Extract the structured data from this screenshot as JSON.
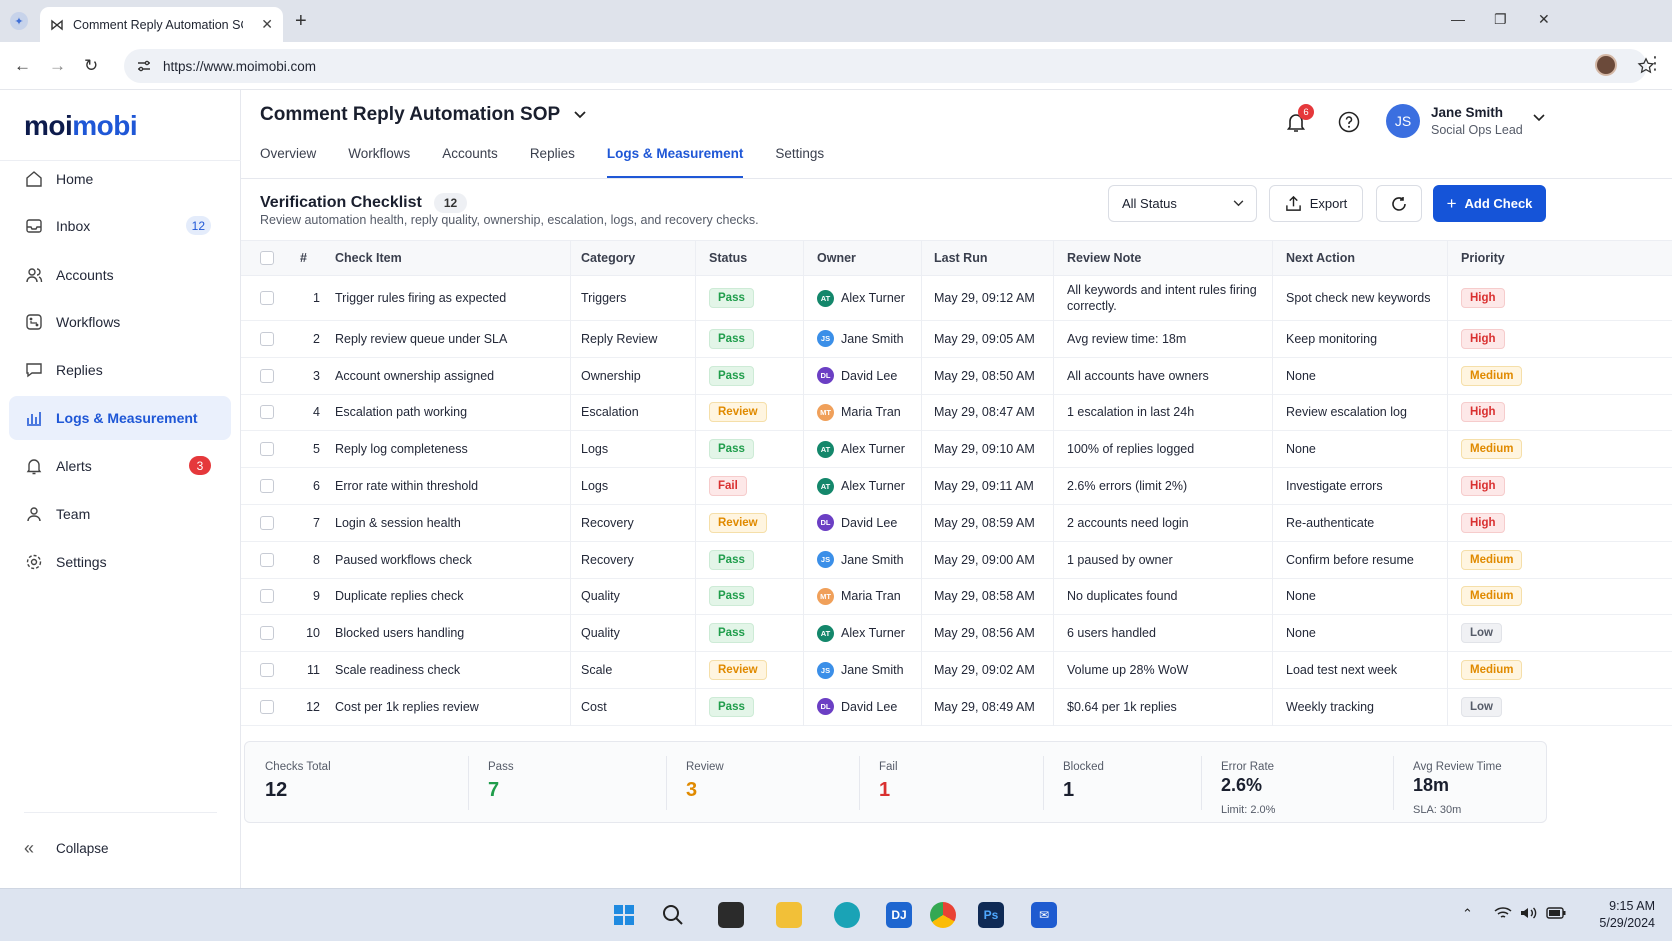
{
  "browser": {
    "tab_title": "Comment Reply Automation SO",
    "url": "https://www.moimobi.com"
  },
  "sidebar": {
    "logo": "moimobi",
    "items": [
      {
        "label": "Home",
        "icon": "home-icon"
      },
      {
        "label": "Inbox",
        "icon": "inbox-icon",
        "badge": "12"
      },
      {
        "label": "Accounts",
        "icon": "accounts-icon"
      },
      {
        "label": "Workflows",
        "icon": "workflows-icon"
      },
      {
        "label": "Replies",
        "icon": "replies-icon"
      },
      {
        "label": "Logs & Measurement",
        "icon": "chart-icon",
        "active": true
      },
      {
        "label": "Alerts",
        "icon": "bell-icon",
        "badge": "3"
      },
      {
        "label": "Team",
        "icon": "team-icon"
      },
      {
        "label": "Settings",
        "icon": "gear-icon"
      }
    ],
    "collapse_label": "Collapse"
  },
  "header": {
    "title": "Comment Reply Automation SOP",
    "tabs": [
      "Overview",
      "Workflows",
      "Accounts",
      "Replies",
      "Logs & Measurement",
      "Settings"
    ],
    "active_tab": "Logs & Measurement",
    "notifications": "6",
    "user": {
      "initials": "JS",
      "name": "Jane Smith",
      "role": "Social Ops Lead"
    }
  },
  "checklist": {
    "title": "Verification Checklist",
    "count": "12",
    "subtitle": "Review automation health, reply quality, ownership, escalation, logs, and recovery checks.",
    "filter_value": "All Status",
    "export_label": "Export",
    "add_label": "Add Check",
    "columns": [
      "#",
      "Check Item",
      "Category",
      "Status",
      "Owner",
      "Last Run",
      "Review Note",
      "Next Action",
      "Priority"
    ],
    "rows": [
      {
        "n": "1",
        "item": "Trigger rules firing as expected",
        "category": "Triggers",
        "status": "Pass",
        "owner": "Alex Turner",
        "initials": "AT",
        "last_run": "May 29, 09:12 AM",
        "note": "All keywords and intent rules firing correctly.",
        "next": "Spot check new keywords",
        "priority": "High"
      },
      {
        "n": "2",
        "item": "Reply review queue under SLA",
        "category": "Reply Review",
        "status": "Pass",
        "owner": "Jane Smith",
        "initials": "JS",
        "last_run": "May 29, 09:05 AM",
        "note": "Avg review time: 18m",
        "next": "Keep monitoring",
        "priority": "High"
      },
      {
        "n": "3",
        "item": "Account ownership assigned",
        "category": "Ownership",
        "status": "Pass",
        "owner": "David Lee",
        "initials": "DL",
        "last_run": "May 29, 08:50 AM",
        "note": "All accounts have owners",
        "next": "None",
        "priority": "Medium"
      },
      {
        "n": "4",
        "item": "Escalation path working",
        "category": "Escalation",
        "status": "Review",
        "owner": "Maria Tran",
        "initials": "MT",
        "last_run": "May 29, 08:47 AM",
        "note": "1 escalation in last 24h",
        "next": "Review escalation log",
        "priority": "High"
      },
      {
        "n": "5",
        "item": "Reply log completeness",
        "category": "Logs",
        "status": "Pass",
        "owner": "Alex Turner",
        "initials": "AT",
        "last_run": "May 29, 09:10 AM",
        "note": "100% of replies logged",
        "next": "None",
        "priority": "Medium"
      },
      {
        "n": "6",
        "item": "Error rate within threshold",
        "category": "Logs",
        "status": "Fail",
        "owner": "Alex Turner",
        "initials": "AT",
        "last_run": "May 29, 09:11 AM",
        "note": "2.6% errors (limit 2%)",
        "next": "Investigate errors",
        "priority": "High"
      },
      {
        "n": "7",
        "item": "Login & session health",
        "category": "Recovery",
        "status": "Review",
        "owner": "David Lee",
        "initials": "DL",
        "last_run": "May 29, 08:59 AM",
        "note": "2 accounts need login",
        "next": "Re-authenticate",
        "priority": "High"
      },
      {
        "n": "8",
        "item": "Paused workflows check",
        "category": "Recovery",
        "status": "Pass",
        "owner": "Jane Smith",
        "initials": "JS",
        "last_run": "May 29, 09:00 AM",
        "note": "1 paused by owner",
        "next": "Confirm before resume",
        "priority": "Medium"
      },
      {
        "n": "9",
        "item": "Duplicate replies check",
        "category": "Quality",
        "status": "Pass",
        "owner": "Maria Tran",
        "initials": "MT",
        "last_run": "May 29, 08:58 AM",
        "note": "No duplicates found",
        "next": "None",
        "priority": "Medium"
      },
      {
        "n": "10",
        "item": "Blocked users handling",
        "category": "Quality",
        "status": "Pass",
        "owner": "Alex Turner",
        "initials": "AT",
        "last_run": "May 29, 08:56 AM",
        "note": "6 users handled",
        "next": "None",
        "priority": "Low"
      },
      {
        "n": "11",
        "item": "Scale readiness check",
        "category": "Scale",
        "status": "Review",
        "owner": "Jane Smith",
        "initials": "JS",
        "last_run": "May 29, 09:02 AM",
        "note": "Volume up 28% WoW",
        "next": "Load test next week",
        "priority": "Medium"
      },
      {
        "n": "12",
        "item": "Cost per 1k replies review",
        "category": "Cost",
        "status": "Pass",
        "owner": "David Lee",
        "initials": "DL",
        "last_run": "May 29, 08:49 AM",
        "note": "$0.64 per 1k replies",
        "next": "Weekly tracking",
        "priority": "Low"
      }
    ]
  },
  "summary": [
    {
      "label": "Checks Total",
      "value": "12",
      "sub": ""
    },
    {
      "label": "Pass",
      "value": "7",
      "sub": ""
    },
    {
      "label": "Review",
      "value": "3",
      "sub": ""
    },
    {
      "label": "Fail",
      "value": "1",
      "sub": ""
    },
    {
      "label": "Blocked",
      "value": "1",
      "sub": ""
    },
    {
      "label": "Error Rate",
      "value": "2.6%",
      "sub": "Limit: 2.0%"
    },
    {
      "label": "Avg Review Time",
      "value": "18m",
      "sub": "SLA: 30m"
    }
  ],
  "colors": {
    "accent": "#1554d8",
    "pass": "#1f9d4b",
    "review": "#e08a00",
    "fail": "#d93030"
  },
  "avatar_colors": {
    "AT": "#14876b",
    "JS": "#3b8fe8",
    "DL": "#6b3fc4",
    "MT": "#f0a05a"
  },
  "taskbar": {
    "time": "9:15 AM",
    "date": "5/29/2024"
  }
}
